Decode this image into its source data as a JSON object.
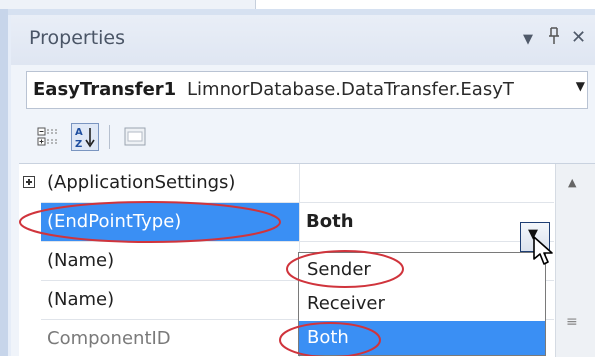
{
  "window": {
    "title": "Properties",
    "pin_glyph": "↓ 1",
    "dropdown_glyph": "▾",
    "pin_icon_glyph": "⫫",
    "close_glyph": "✕"
  },
  "object_selector": {
    "name": "EasyTransfer1",
    "type": "LimnorDatabase.DataTransfer.EasyT",
    "arrow": "▾"
  },
  "toolbar": {
    "categorized_icon": "categorized-icon",
    "alphabetical_icon": "alphabetical-icon",
    "property_pages_icon": "property-pages-icon"
  },
  "grid": {
    "rows": [
      {
        "name": "(ApplicationSettings)",
        "value": "",
        "expandable": true
      },
      {
        "name": "(EndPointType)",
        "value": "Both",
        "selected": true
      },
      {
        "name": "(Name)",
        "value": ""
      },
      {
        "name": "(Name)",
        "value": ""
      },
      {
        "name": "ComponentID",
        "value": "",
        "grey": true
      }
    ]
  },
  "dropdown": {
    "options": [
      "Sender",
      "Receiver",
      "Both"
    ],
    "selected": "Both"
  },
  "colors": {
    "selection_blue": "#3a8ff4",
    "annotation_red": "#d0343c"
  }
}
